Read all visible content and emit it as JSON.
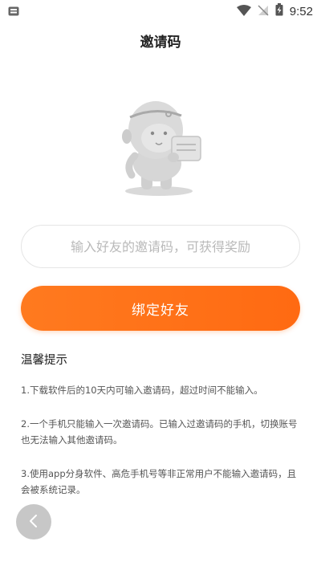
{
  "status_bar": {
    "time": "9:52",
    "icons": [
      "sim-card-icon",
      "wifi-icon",
      "no-signal-icon",
      "battery-charging-icon"
    ]
  },
  "header": {
    "title": "邀请码"
  },
  "mascot": {
    "icon": "mascot-holding-card-icon"
  },
  "form": {
    "input_placeholder": "输入好友的邀请码，可获得奖励",
    "input_value": "",
    "submit_label": "绑定好友"
  },
  "tips": {
    "title": "温馨提示",
    "items": [
      "1.下载软件后的10天内可输入邀请码，超过时间不能输入。",
      "2.一个手机只能输入一次邀请码。已输入过邀请码的手机，切换账号也无法输入其他邀请码。",
      "3.使用app分身软件、高危手机号等非正常用户不能输入邀请码，且会被系统记录。"
    ]
  },
  "nav": {
    "back_icon": "chevron-left-icon"
  },
  "colors": {
    "accent": "#ff6f17",
    "input_border": "#e5e5e5",
    "placeholder": "#b9b9b9",
    "back_button": "#c7c7c7"
  }
}
